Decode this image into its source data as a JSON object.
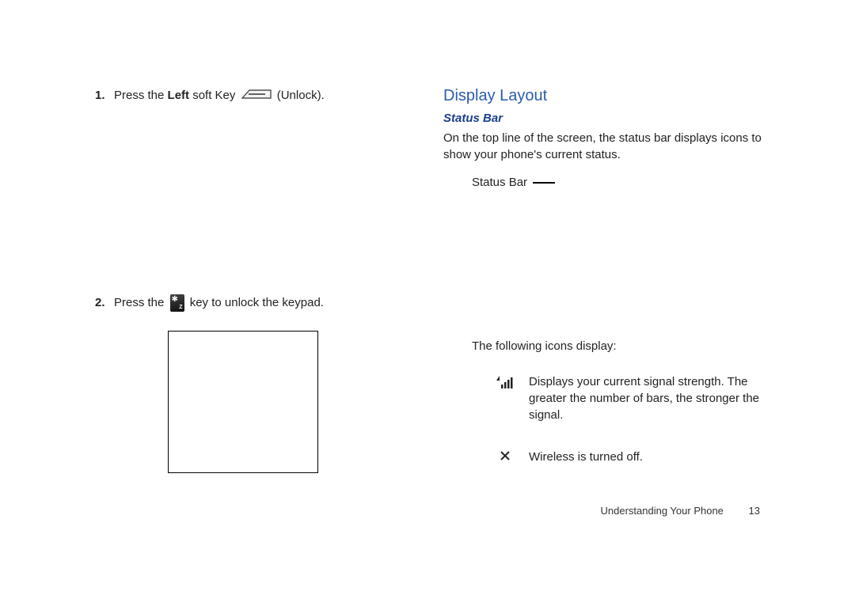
{
  "left": {
    "step1": {
      "num": "1.",
      "pre": "Press the ",
      "bold": "Left",
      "mid": " soft Key ",
      "post": " (Unlock)."
    },
    "step2": {
      "num": "2.",
      "pre": "Press the ",
      "post": " key to unlock the keypad."
    }
  },
  "right": {
    "section_title": "Display Layout",
    "subsection": "Status Bar",
    "para1": "On the top line of the screen, the status bar displays icons to show your phone's current status.",
    "statusbar_label": "Status Bar",
    "icons_intro": "The following icons display:",
    "rows": [
      {
        "desc": "Displays your current signal strength. The greater the number of bars, the stronger the signal."
      },
      {
        "desc": "Wireless is turned off."
      }
    ]
  },
  "footer": {
    "section": "Understanding Your Phone",
    "page": "13"
  }
}
